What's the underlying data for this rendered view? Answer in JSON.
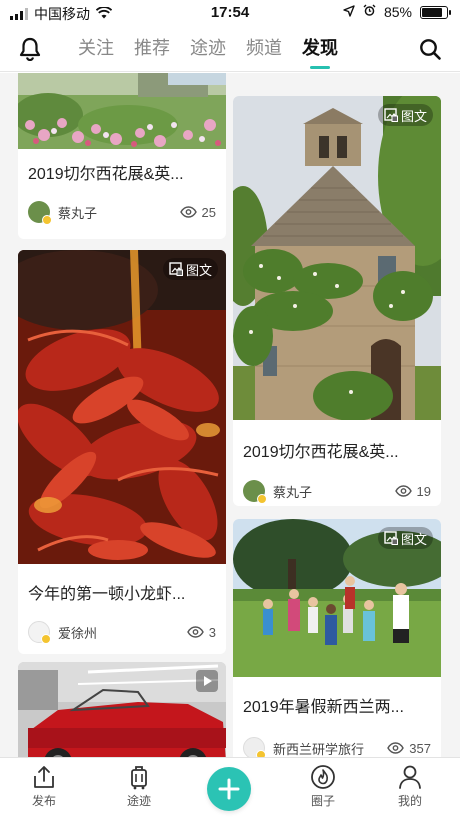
{
  "status": {
    "carrier": "中国移动",
    "time": "17:54",
    "battery": "85%",
    "battery_level": 0.85
  },
  "nav": {
    "tabs": [
      "关注",
      "推荐",
      "途迹",
      "频道",
      "发现"
    ],
    "active_tab": "发现"
  },
  "cards": [
    {
      "title": "2019切尔西花展&英...",
      "author": "蔡丸子",
      "views": "25"
    },
    {
      "title": "今年的第一顿小龙虾...",
      "author": "爱徐州",
      "views": "3",
      "badge": "图文"
    },
    {
      "title": "2019切尔西花展&英...",
      "author": "蔡丸子",
      "views": "19",
      "badge": "图文"
    },
    {
      "title": "2019年暑假新西兰两...",
      "author": "新西兰研学旅行",
      "views": "357",
      "badge": "图文"
    }
  ],
  "bottom_nav": [
    {
      "label": "发布",
      "icon": "publish-icon"
    },
    {
      "label": "途迹",
      "icon": "luggage-icon"
    },
    {
      "label": "",
      "icon": "plus-icon"
    },
    {
      "label": "圈子",
      "icon": "flame-circle-icon"
    },
    {
      "label": "我的",
      "icon": "person-icon"
    }
  ],
  "colors": {
    "accent": "#2bc3b4"
  }
}
